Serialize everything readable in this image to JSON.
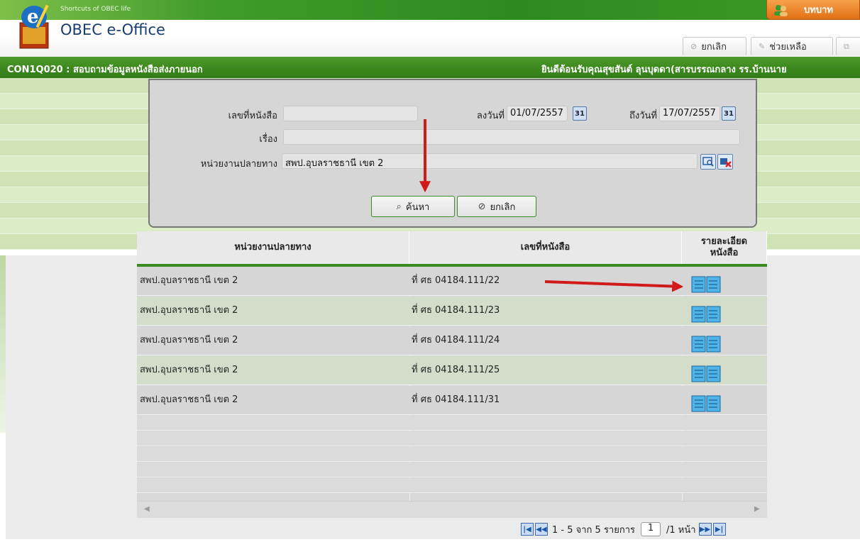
{
  "header": {
    "tagline": "Shortcuts of OBEC life",
    "app_name": "OBEC e-Office",
    "user_tab_label": "บทบาท",
    "buttons": {
      "cancel": "ยกเลิก",
      "help": "ช่วยเหลือ"
    }
  },
  "title_bar": {
    "screen_title": "CON1Q020 : สอบถามข้อมูลหนังสือส่งภายนอก",
    "welcome": "ยินดีต้อนรับคุณสุขสันต์ ลุนบุดดา(สารบรรณกลาง รร.บ้านนาย"
  },
  "search": {
    "doc_no_label": "เลขที่หนังสือ",
    "doc_no_value": "",
    "date_from_label": "ลงวันที่",
    "date_from": "01/07/2557",
    "date_to_label": "ถึงวันที่",
    "date_to": "17/07/2557",
    "subject_label": "เรื่อง",
    "subject_value": "",
    "dest_label": "หน่วยงานปลายทาง",
    "dest_value": "สพป.อุบลราชธานี เขต 2",
    "calendar_glyph": "31",
    "search_button": "ค้นหา",
    "cancel_button": "ยกเลิก"
  },
  "table": {
    "headers": [
      "หน่วยงานปลายทาง",
      "เลขที่หนังสือ",
      "รายละเอียด",
      "หนังสือ"
    ],
    "rows": [
      {
        "dest": "สพป.อุบลราชธานี เขต 2",
        "doc_no": "ที่ ศธ 04184.111/22"
      },
      {
        "dest": "สพป.อุบลราชธานี เขต 2",
        "doc_no": "ที่ ศธ 04184.111/23"
      },
      {
        "dest": "สพป.อุบลราชธานี เขต 2",
        "doc_no": "ที่ ศธ 04184.111/24"
      },
      {
        "dest": "สพป.อุบลราชธานี เขต 2",
        "doc_no": "ที่ ศธ 04184.111/25"
      },
      {
        "dest": "สพป.อุบลราชธานี เขต 2",
        "doc_no": "ที่ ศธ 04184.111/31"
      }
    ]
  },
  "pager": {
    "range": "1 - 5 จาก 5 รายการ",
    "page": "1",
    "total": "/1 หน้า"
  },
  "colors": {
    "header_green": "#2f7a15",
    "accent_orange": "#e06f14",
    "annotation_red": "#d11a1a",
    "book_icon": "#2e8fd0"
  }
}
